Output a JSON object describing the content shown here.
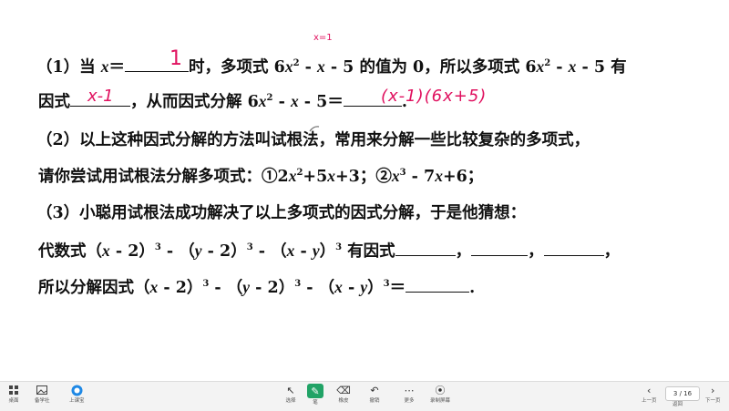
{
  "question": {
    "line1": {
      "p1": "（1）当 ",
      "var_x": "x",
      "eq": "＝",
      "p2": "时，多项式 6",
      "x1": "x",
      "sup2": "2",
      "p3": " - ",
      "x2": "x",
      "p4": " - 5 的值为 0，所以多项式 6",
      "x3": "x",
      "sup2b": "2",
      "p5": " - ",
      "x4": "x",
      "p6": " - 5 有"
    },
    "line2": {
      "p1": "因式",
      "p2": "，从而因式分解 6",
      "x1": "x",
      "sup2": "2",
      "p3": " - ",
      "x2": "x",
      "p4": " - 5＝",
      "p5": "."
    },
    "line3": "（2）以上这种因式分解的方法叫试根法，常用来分解一些比较复杂的多项式，",
    "line4": {
      "p1": "请你尝试用试根法分解多项式：①2",
      "x1": "x",
      "sup2": "2",
      "p2": "+5",
      "x2": "x",
      "p3": "+3；②",
      "x3": "x",
      "sup3": "3",
      "p4": " - 7",
      "x4": "x",
      "p5": "+6；"
    },
    "line5": "（3）小聪用试根法成功解决了以上多项式的因式分解，于是他猜想：",
    "line6": {
      "p1": "代数式（",
      "x1": "x",
      "p2": " - 2）",
      "sup3a": "3",
      "p3": " - （",
      "y1": "y",
      "p4": " - 2）",
      "sup3b": "3",
      "p5": " - （",
      "x2": "x",
      "p6": " - ",
      "y2": "y",
      "p7": "）",
      "sup3c": "3",
      "p8": " 有因式",
      "c1": "，",
      "c2": "，",
      "c3": "，"
    },
    "line7": {
      "p1": "所以分解因式（",
      "x1": "x",
      "p2": " - 2）",
      "sup3a": "3",
      "p3": " - （",
      "y1": "y",
      "p4": " - 2）",
      "sup3b": "3",
      "p5": " - （",
      "x2": "x",
      "p6": " - ",
      "y2": "y",
      "p7": "）",
      "sup3c": "3",
      "p8": "＝",
      "p9": "."
    }
  },
  "handwriting": {
    "note_top": "x=1",
    "blank1": "1",
    "blank2": "x-1",
    "answer": "(x-1)(6x+5)"
  },
  "toolbar": {
    "left": [
      {
        "label": "桌面",
        "icon": "grid-icon"
      },
      {
        "label": "备学社",
        "icon": "image-icon"
      },
      {
        "label": "上课宝",
        "icon": "app-logo-icon"
      }
    ],
    "tools": [
      {
        "label": "选择",
        "icon": "cursor-icon",
        "glyph": "↖"
      },
      {
        "label": "笔",
        "icon": "pen-icon",
        "glyph": "✎"
      },
      {
        "label": "橡皮",
        "icon": "eraser-icon",
        "glyph": "⌫"
      },
      {
        "label": "撤销",
        "icon": "undo-icon",
        "glyph": "↶"
      },
      {
        "label": "更多",
        "icon": "more-icon",
        "glyph": "⋯"
      },
      {
        "label": "录制屏幕",
        "icon": "record-icon",
        "glyph": "⦿"
      }
    ],
    "nav": {
      "prev": "上一页",
      "back": "返回",
      "page": "3 / 16",
      "next": "下一页"
    }
  },
  "colors": {
    "ink": "#e0115f",
    "toolbar_bg": "#f3f3f3",
    "active_tool": "#21a366"
  }
}
